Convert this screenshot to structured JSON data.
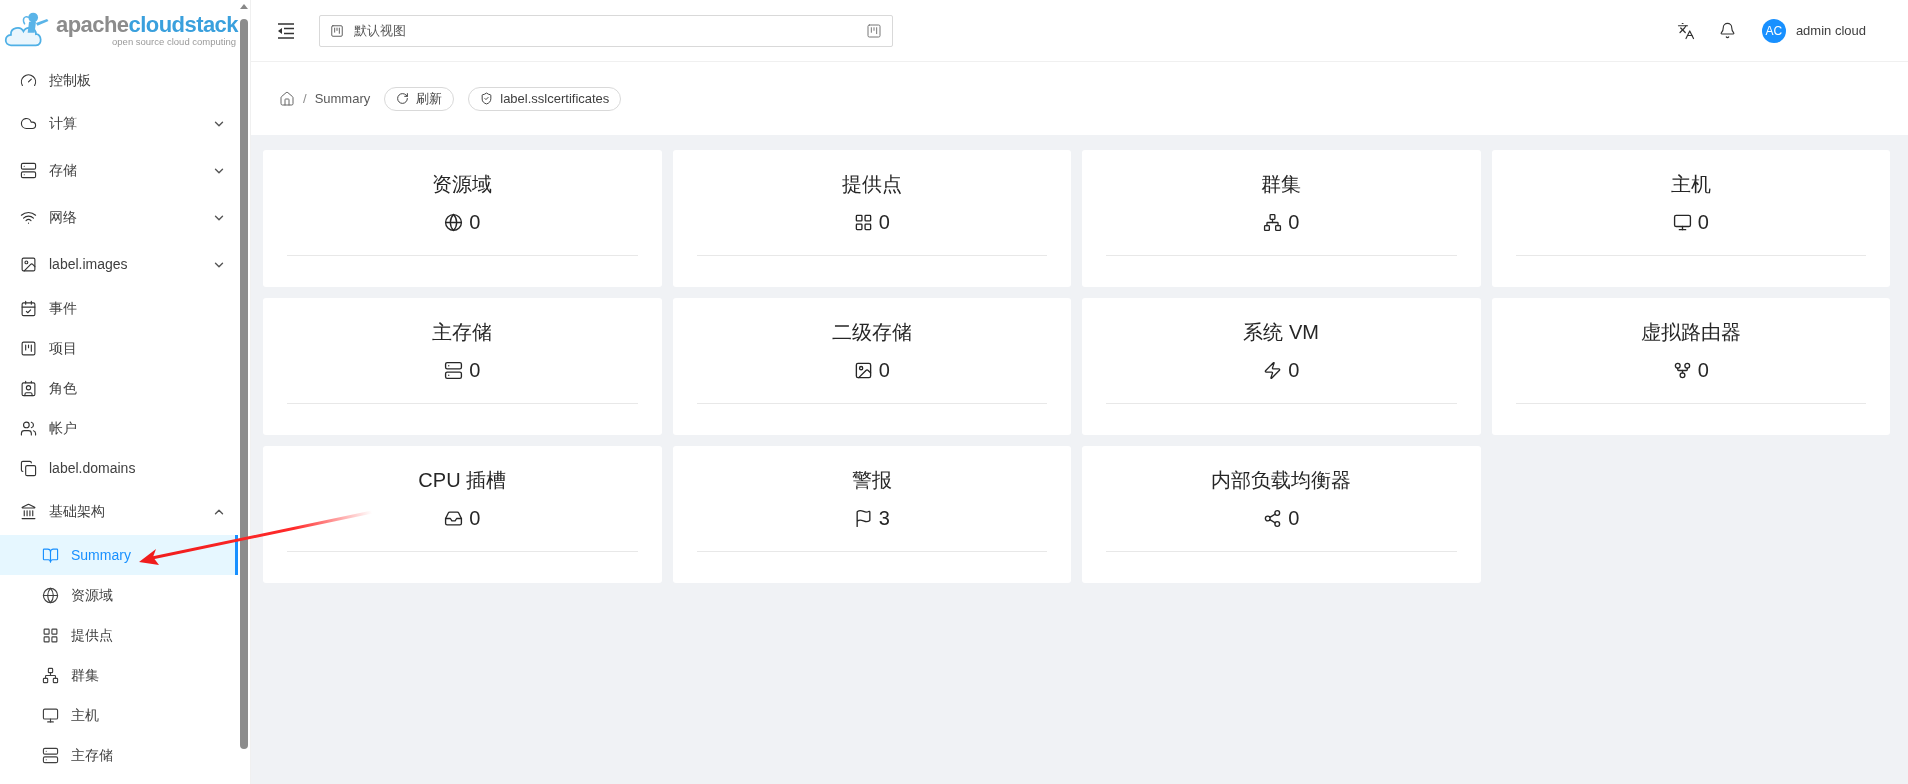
{
  "logo": {
    "brand_a": "apache",
    "brand_b": "cloudstack",
    "tagline": "open source cloud computing"
  },
  "sidebar": {
    "items": [
      {
        "label": "控制板",
        "kind": "link"
      },
      {
        "label": "计算",
        "kind": "group",
        "expanded": false
      },
      {
        "label": "存储",
        "kind": "group",
        "expanded": false
      },
      {
        "label": "网络",
        "kind": "group",
        "expanded": false
      },
      {
        "label": "label.images",
        "kind": "group",
        "expanded": false
      },
      {
        "label": "事件",
        "kind": "link"
      },
      {
        "label": "项目",
        "kind": "link"
      },
      {
        "label": "角色",
        "kind": "link"
      },
      {
        "label": "帐户",
        "kind": "link"
      },
      {
        "label": "label.domains",
        "kind": "link"
      },
      {
        "label": "基础架构",
        "kind": "group",
        "expanded": true,
        "children": [
          {
            "label": "Summary",
            "selected": true
          },
          {
            "label": "资源域",
            "selected": false
          },
          {
            "label": "提供点",
            "selected": false
          },
          {
            "label": "群集",
            "selected": false
          },
          {
            "label": "主机",
            "selected": false
          },
          {
            "label": "主存储",
            "selected": false
          }
        ]
      }
    ]
  },
  "header": {
    "view_select": "默认视图",
    "avatar": "AC",
    "user": "admin cloud"
  },
  "breadcrumb": {
    "separator": "/",
    "current": "Summary",
    "buttons": [
      "刷新",
      "label.sslcertificates"
    ]
  },
  "cards": [
    {
      "title": "资源域",
      "value": "0"
    },
    {
      "title": "提供点",
      "value": "0"
    },
    {
      "title": "群集",
      "value": "0"
    },
    {
      "title": "主机",
      "value": "0"
    },
    {
      "title": "主存储",
      "value": "0"
    },
    {
      "title": "二级存储",
      "value": "0"
    },
    {
      "title": "系统 VM",
      "value": "0"
    },
    {
      "title": "虚拟路由器",
      "value": "0"
    },
    {
      "title": "CPU 插槽",
      "value": "0"
    },
    {
      "title": "警报",
      "value": "3"
    },
    {
      "title": "内部负载均衡器",
      "value": "0"
    }
  ],
  "annotation": {
    "kind": "arrow"
  }
}
